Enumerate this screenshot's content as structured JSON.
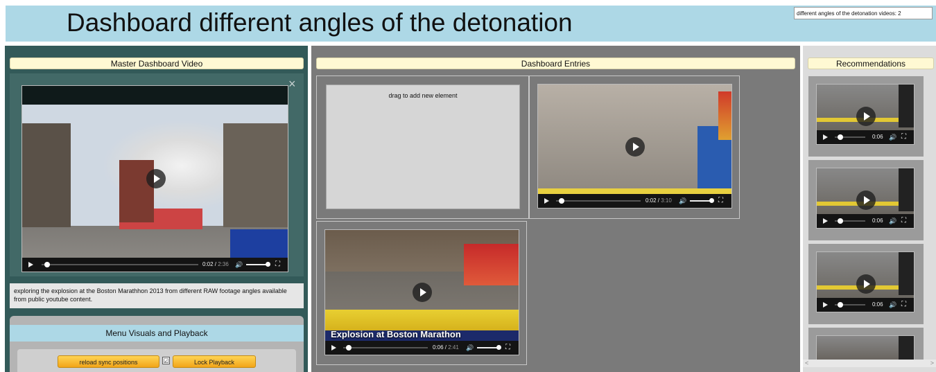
{
  "header": {
    "title": "Dashboard different angles of the detonation",
    "count_text": "different angles of the detonation videos: 2"
  },
  "left": {
    "section_label": "Master Dashboard Video",
    "description": "exploring the explosion at the Boston Marathhon 2013 from different RAW footage angles available from public youtube content.",
    "video": {
      "current": "0:02",
      "duration": "2:36",
      "progress": 0.01,
      "volume": 1.0
    },
    "menu": {
      "title": "Menu Visuals and Playback",
      "reload_label": "reload sync positions",
      "lock_label": "Lock Playback",
      "checkbox_mark": "☑",
      "checked": true
    }
  },
  "middle": {
    "section_label": "Dashboard Entries",
    "drop_text": "drag to add new element",
    "videos": [
      {
        "current": "0:02",
        "duration": "3:10",
        "progress": 0.01,
        "volume": 1.0
      },
      {
        "current": "0:06",
        "duration": "2:41",
        "overlay_title": "Explosion at Boston Marathon",
        "progress": 0.04,
        "volume": 1.0
      }
    ]
  },
  "right": {
    "section_label": "Recommendations",
    "videos": [
      {
        "current": "0:06"
      },
      {
        "current": "0:06"
      },
      {
        "current": "0:06"
      }
    ]
  },
  "icons": {
    "close": "×",
    "volume": "🔊",
    "fullscreen": "⛶",
    "scroll_left": "<",
    "scroll_right": ">"
  },
  "colors": {
    "header_bg": "#add8e6",
    "left_bg": "#335a59",
    "middle_bg": "#7a7a7a",
    "label_bg": "#fff9d3",
    "button_bg": "#f2a418"
  }
}
